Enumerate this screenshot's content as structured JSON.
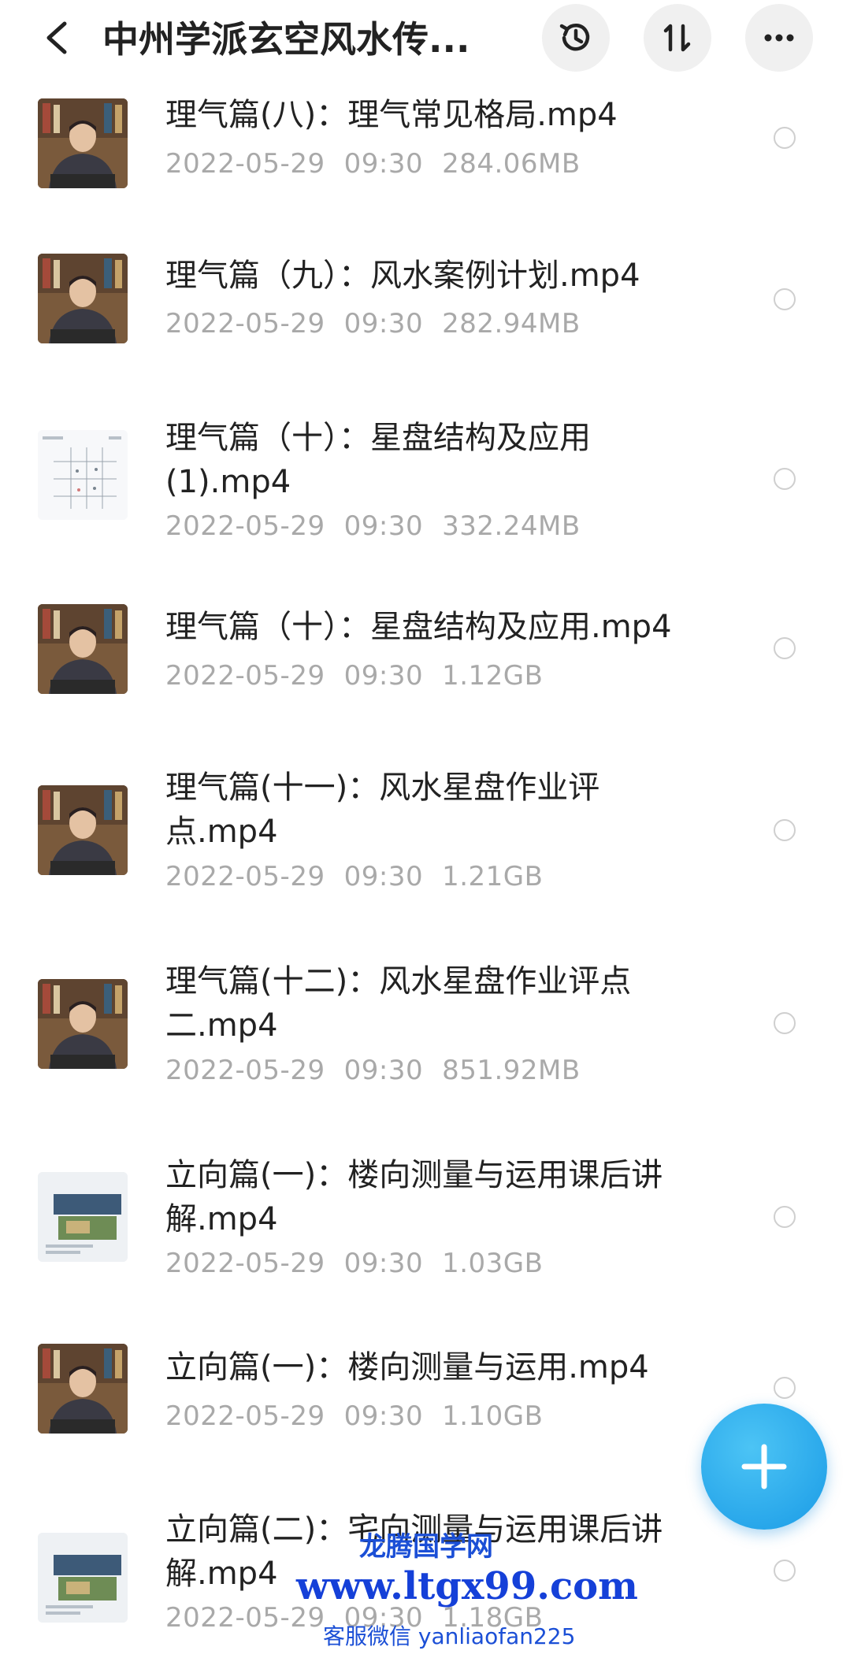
{
  "header": {
    "title": "中州学派玄空风水传...",
    "back_icon": "chevron-left-icon",
    "history_icon": "history-icon",
    "sort_icon": "sort-icon",
    "more_icon": "more-icon"
  },
  "files": [
    {
      "name": "理气篇(八)：理气常见格局.mp4",
      "date": "2022-05-29",
      "time": "09:30",
      "size": "284.06MB",
      "thumb": "lecturer-video"
    },
    {
      "name": "理气篇（九）：风水案例计划.mp4",
      "date": "2022-05-29",
      "time": "09:30",
      "size": "282.94MB",
      "thumb": "lecturer-video"
    },
    {
      "name": "理气篇（十）：星盘结构及应用(1).mp4",
      "date": "2022-05-29",
      "time": "09:30",
      "size": "332.24MB",
      "thumb": "chart-video"
    },
    {
      "name": "理气篇（十）：星盘结构及应用.mp4",
      "date": "2022-05-29",
      "time": "09:30",
      "size": "1.12GB",
      "thumb": "lecturer-video"
    },
    {
      "name": "理气篇(十一)：风水星盘作业评点.mp4",
      "date": "2022-05-29",
      "time": "09:30",
      "size": "1.21GB",
      "thumb": "lecturer-video"
    },
    {
      "name": "理气篇(十二)：风水星盘作业评点二.mp4",
      "date": "2022-05-29",
      "time": "09:30",
      "size": "851.92MB",
      "thumb": "lecturer-video"
    },
    {
      "name": "立向篇(一)：楼向测量与运用课后讲解.mp4",
      "date": "2022-05-29",
      "time": "09:30",
      "size": "1.03GB",
      "thumb": "slide-video"
    },
    {
      "name": "立向篇(一)：楼向测量与运用.mp4",
      "date": "2022-05-29",
      "time": "09:30",
      "size": "1.10GB",
      "thumb": "lecturer-video"
    },
    {
      "name": "立向篇(二)：宅向测量与运用课后讲解.mp4",
      "date": "2022-05-29",
      "time": "09:30",
      "size": "1.18GB",
      "thumb": "slide-video"
    }
  ],
  "fab": {
    "icon": "plus-icon"
  },
  "watermark": {
    "line1": "龙腾国学网",
    "line2": "www.ltgx99.com",
    "line3": "客服微信 yanliaofan225"
  },
  "colors": {
    "accent": "#1a9be6",
    "watermark": "#1b4fd6",
    "meta": "#a9a9a9"
  }
}
